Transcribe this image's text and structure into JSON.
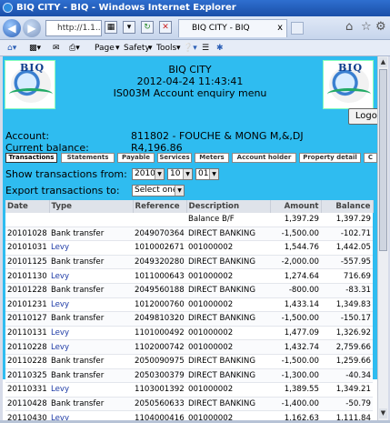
{
  "window": {
    "title": "BIQ CITY - BIQ - Windows Internet Explorer"
  },
  "browser": {
    "address": "http://1.1...",
    "tab_title": "BIQ CITY - BIQ",
    "tab_close": "x",
    "command_bar": {
      "page_label": "Page",
      "safety_label": "Safety",
      "tools_label": "Tools"
    }
  },
  "header": {
    "logo_text": "BIQ",
    "site_name": "BIQ CITY",
    "datetime": "2012-04-24 11:43:41",
    "menu_title": "IS003M Account enquiry menu",
    "logout_label": "Logout"
  },
  "account": {
    "account_label": "Account:",
    "account_value": "811802 - FOUCHE & MONG M,&,DJ",
    "balance_label": "Current balance:",
    "balance_value": "R4,196.86"
  },
  "tabs": [
    {
      "label": "Transactions",
      "active": true
    },
    {
      "label": "Statements",
      "active": false
    },
    {
      "label": "Payable",
      "active": false
    },
    {
      "label": "Services",
      "active": false
    },
    {
      "label": "Meters",
      "active": false
    },
    {
      "label": "Account holder",
      "active": false
    },
    {
      "label": "Property detail",
      "active": false
    },
    {
      "label": "C",
      "active": false
    }
  ],
  "filters": {
    "show_from_label": "Show transactions from:",
    "year": "2010",
    "month": "10",
    "day": "01",
    "export_label": "Export transactions to:",
    "export_value": "Select one"
  },
  "table": {
    "columns": [
      "Date",
      "Type",
      "Reference",
      "Description",
      "Amount",
      "Balance"
    ],
    "rows": [
      [
        "",
        "",
        "",
        "Balance B/F",
        "1,397.29",
        "1,397.29"
      ],
      [
        "20101028",
        "Bank transfer",
        "2049070364",
        "DIRECT BANKING",
        "-1,500.00",
        "-102.71"
      ],
      [
        "20101031",
        "Levy",
        "1010002671",
        "001000002",
        "1,544.76",
        "1,442.05"
      ],
      [
        "20101125",
        "Bank transfer",
        "2049320280",
        "DIRECT BANKING",
        "-2,000.00",
        "-557.95"
      ],
      [
        "20101130",
        "Levy",
        "1011000643",
        "001000002",
        "1,274.64",
        "716.69"
      ],
      [
        "20101228",
        "Bank transfer",
        "2049560188",
        "DIRECT BANKING",
        "-800.00",
        "-83.31"
      ],
      [
        "20101231",
        "Levy",
        "1012000760",
        "001000002",
        "1,433.14",
        "1,349.83"
      ],
      [
        "20110127",
        "Bank transfer",
        "2049810320",
        "DIRECT BANKING",
        "-1,500.00",
        "-150.17"
      ],
      [
        "20110131",
        "Levy",
        "1101000492",
        "001000002",
        "1,477.09",
        "1,326.92"
      ],
      [
        "20110228",
        "Levy",
        "1102000742",
        "001000002",
        "1,432.74",
        "2,759.66"
      ],
      [
        "20110228",
        "Bank transfer",
        "2050090975",
        "DIRECT BANKING",
        "-1,500.00",
        "1,259.66"
      ],
      [
        "20110325",
        "Bank transfer",
        "2050300379",
        "DIRECT BANKING",
        "-1,300.00",
        "-40.34"
      ],
      [
        "20110331",
        "Levy",
        "1103001392",
        "001000002",
        "1,389.55",
        "1,349.21"
      ],
      [
        "20110428",
        "Bank transfer",
        "2050560633",
        "DIRECT BANKING",
        "-1,400.00",
        "-50.79"
      ],
      [
        "20110430",
        "Levy",
        "1104000416",
        "001000002",
        "1,162.63",
        "1,111.84"
      ]
    ]
  }
}
